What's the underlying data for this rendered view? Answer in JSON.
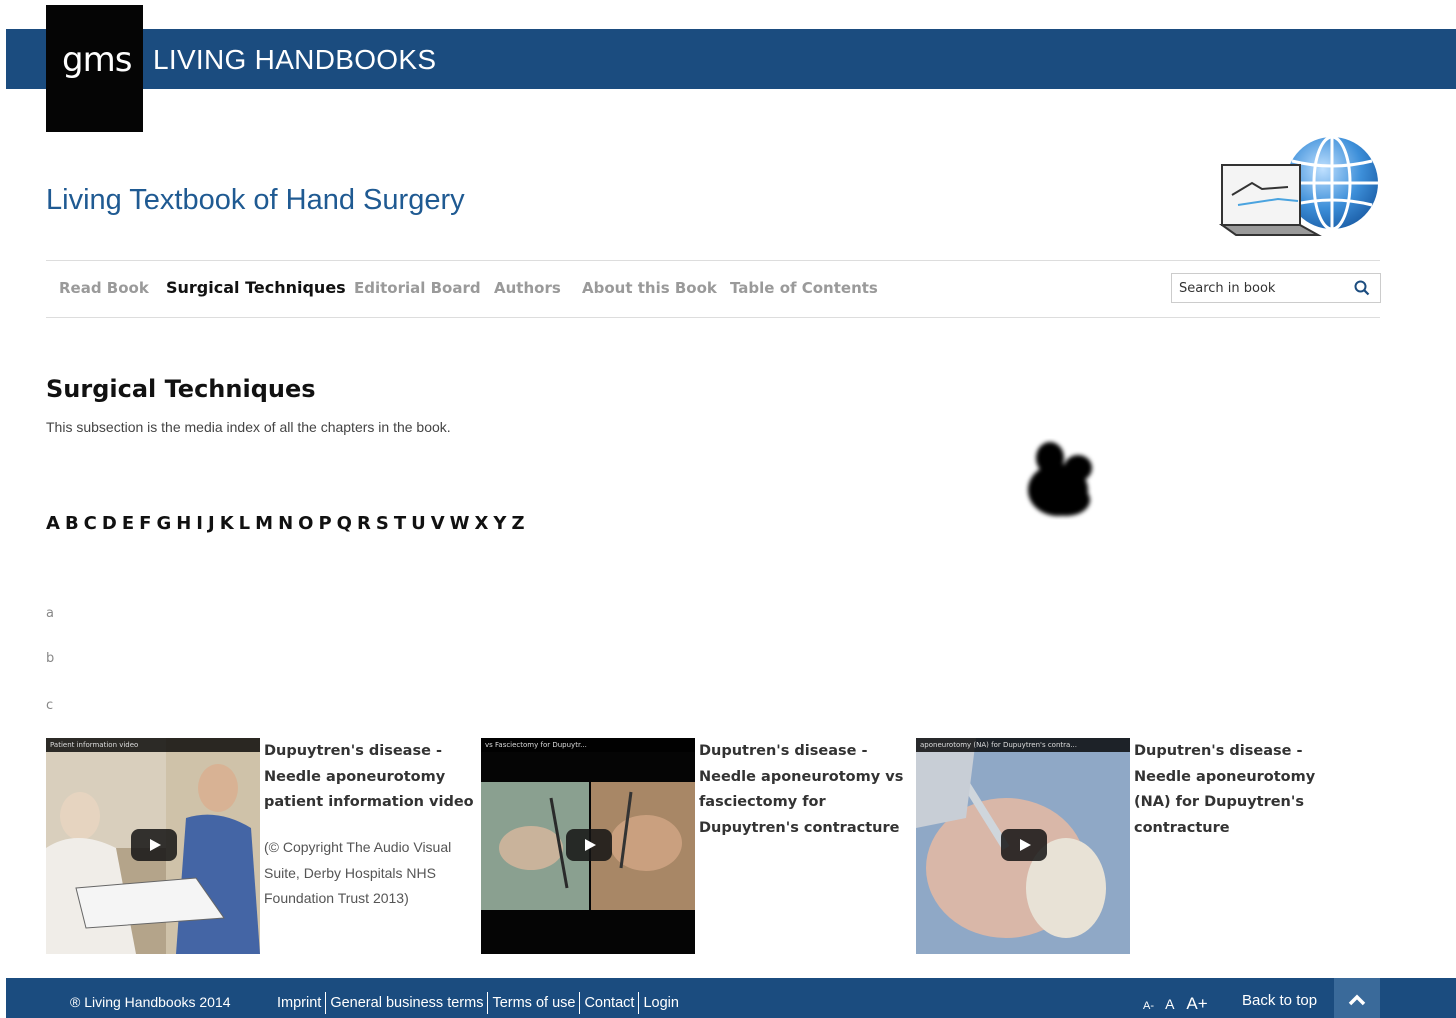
{
  "header": {
    "logo_text": "gms",
    "brand": "LIVING HANDBOOKS"
  },
  "book_title": "Living Textbook of Hand Surgery",
  "nav": {
    "items": [
      {
        "label": "Read Book",
        "active": false
      },
      {
        "label": "Surgical Techniques",
        "active": true
      },
      {
        "label": "Editorial Board",
        "active": false
      },
      {
        "label": "Authors",
        "active": false
      },
      {
        "label": "About this Book",
        "active": false
      },
      {
        "label": "Table of Contents",
        "active": false
      }
    ],
    "search_placeholder": "Search in book"
  },
  "section": {
    "title": "Surgical Techniques",
    "description": "This subsection is the media index of all the chapters in the book."
  },
  "alphabet": [
    "A",
    "B",
    "C",
    "D",
    "E",
    "F",
    "G",
    "H",
    "I",
    "J",
    "K",
    "L",
    "M",
    "N",
    "O",
    "P",
    "Q",
    "R",
    "S",
    "T",
    "U",
    "V",
    "W",
    "X",
    "Y",
    "Z"
  ],
  "letter_anchors": [
    "a",
    "b",
    "c"
  ],
  "media": [
    {
      "title": "Dupuytren's disease - Needle aponeurotomy patient information video",
      "credit": "(© Copyright The Audio Visual Suite, Derby Hospitals NHS Foundation Trust 2013)",
      "thumb_caption": "Patient information video"
    },
    {
      "title": "Duputren's disease - Needle aponeurotomy vs fasciectomy for Dupuytren's contracture",
      "credit": "",
      "thumb_caption": "vs Fasciectomy for Dupuytr..."
    },
    {
      "title": "Duputren's disease - Needle aponeurotomy (NA) for Dupuytren's contracture",
      "credit": "",
      "thumb_caption": "aponeurotomy (NA) for Dupuytren's contra..."
    }
  ],
  "footer": {
    "copyright": "® Living Handbooks 2014",
    "links": [
      "Imprint",
      "General business terms",
      "Terms of use",
      "Contact",
      "Login"
    ],
    "font_sizes": [
      "A-",
      "A",
      "A+"
    ],
    "back_to_top": "Back to top"
  },
  "colors": {
    "brand_blue": "#1b4c7f",
    "title_blue": "#1f5a92"
  }
}
